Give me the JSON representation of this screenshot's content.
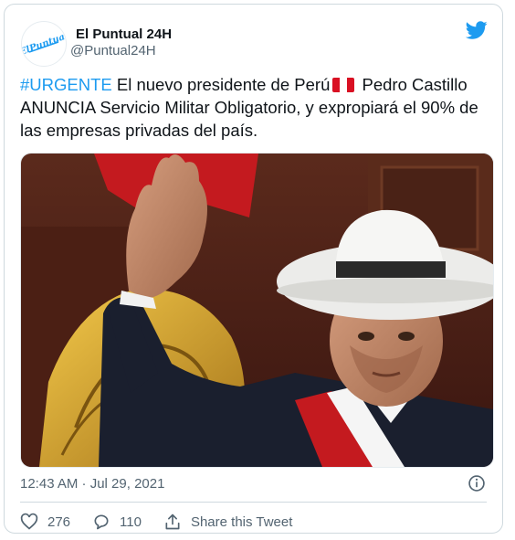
{
  "author": {
    "name": "El Puntual 24H",
    "handle": "@Puntual24H",
    "avatar_text": "ElPuntual"
  },
  "tweet": {
    "hashtag": "#URGENTE",
    "text_line1": "El nuevo presidente de Perú",
    "text_rest": "Pedro Castillo ANUNCIA Servicio Militar Obligatorio, y expropiará el 90% de las empresas privadas del país."
  },
  "meta": {
    "timestamp": "12:43 AM · Jul 29, 2021"
  },
  "actions": {
    "likes": "276",
    "replies": "110",
    "share_label": "Share this Tweet"
  },
  "colors": {
    "accent": "#1d9bf0",
    "text": "#0f1419",
    "muted": "#536471",
    "peru_red": "#d91023"
  },
  "icons": [
    "twitter-bird-icon",
    "info-icon",
    "heart-icon",
    "reply-icon",
    "share-icon",
    "peru-flag-icon"
  ]
}
